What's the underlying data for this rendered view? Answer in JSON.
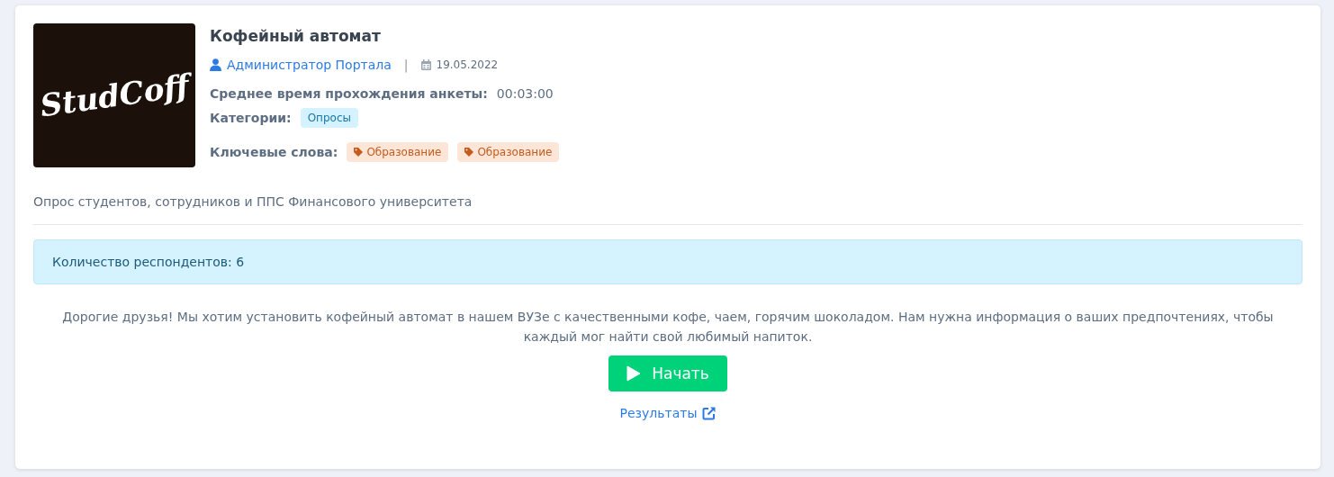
{
  "card": {
    "logo": {
      "text": "StudCoff"
    },
    "title": "Кофейный автомат",
    "author": "Администратор Портала",
    "separator": "|",
    "date": "19.05.2022",
    "avg_time": {
      "label": "Среднее время прохождения анкеты:",
      "value": "00:03:00"
    },
    "categories": {
      "label": "Категории:",
      "items": [
        "Опросы"
      ]
    },
    "keywords": {
      "label": "Ключевые слова:",
      "items": [
        "Образование",
        "Образование"
      ]
    },
    "subtitle": "Опрос студентов, сотрудников и ППС Финансового университета",
    "respondents": "Количество респондентов: 6",
    "description": "Дорогие друзья! Мы хотим установить кофейный автомат в нашем ВУЗе с качественными кофе, чаем, горячим шоколадом. Нам нужна информация о ваших предпочтениях, чтобы каждый мог найти свой любимый напиток.",
    "start_button": "Начать",
    "results_link": "Результаты"
  }
}
